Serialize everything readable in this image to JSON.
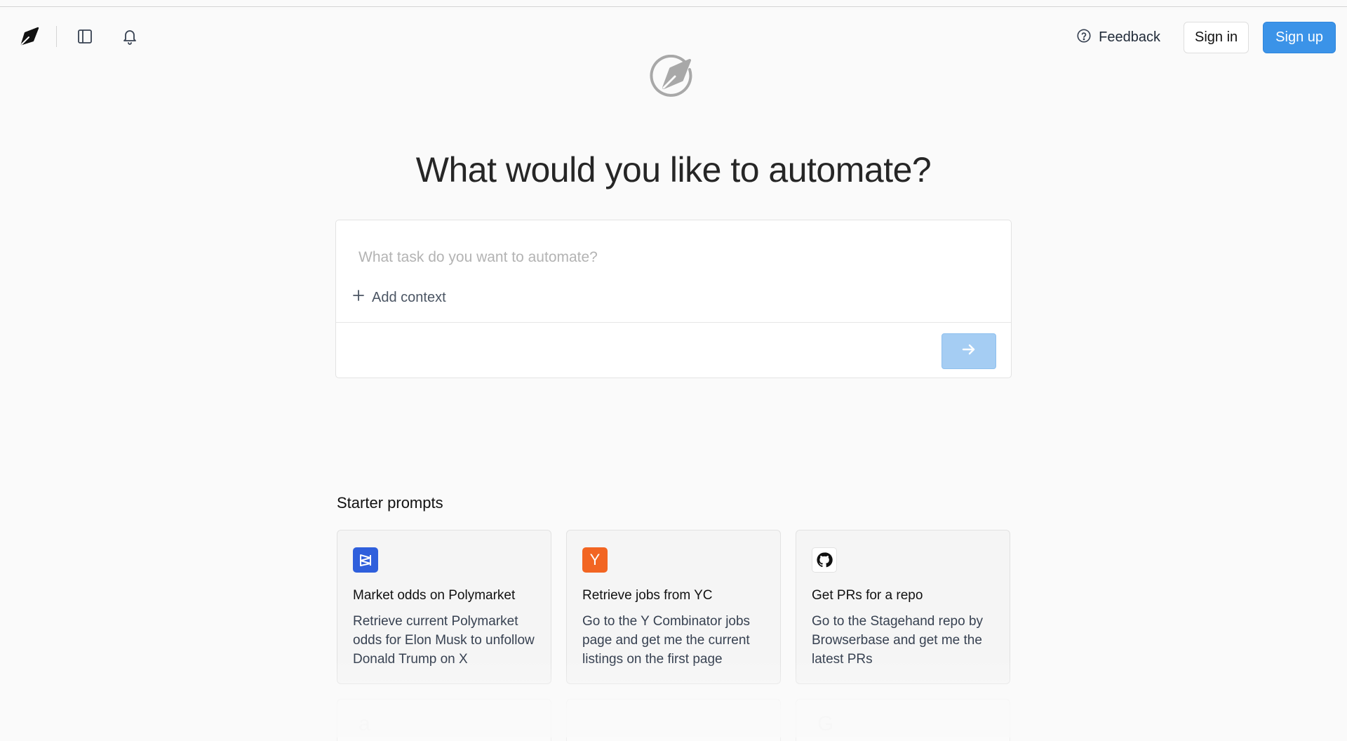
{
  "header": {
    "logo_icon": "quill-logo-icon",
    "sidebar_toggle_icon": "sidebar-panel-icon",
    "notifications_icon": "bell-icon",
    "feedback_label": "Feedback",
    "signin_label": "Sign in",
    "signup_label": "Sign up"
  },
  "hero": {
    "icon": "compass-quill-icon",
    "title": "What would you like to automate?"
  },
  "composer": {
    "placeholder": "What task do you want to automate?",
    "value": "",
    "add_context_label": "Add context",
    "send_icon": "arrow-right-icon"
  },
  "starter": {
    "title": "Starter prompts",
    "cards": [
      {
        "icon": "polymarket-logo",
        "title": "Market odds on Polymarket",
        "description": "Retrieve current Polymarket odds for Elon Musk to unfollow Donald Trump on X"
      },
      {
        "icon": "ycombinator-logo",
        "logo_text": "Y",
        "title": "Retrieve jobs from YC",
        "description": "Go to the Y Combinator jobs page and get me the current listings on the first page"
      },
      {
        "icon": "github-logo",
        "title": "Get PRs for a repo",
        "description": "Go to the Stagehand repo by Browserbase and get me the latest PRs"
      }
    ],
    "faded_cards": [
      {
        "glyph": "a"
      },
      {
        "glyph": ""
      },
      {
        "glyph": "G"
      }
    ]
  },
  "colors": {
    "accent": "#3b93e8",
    "send_disabled": "#a5cdf3",
    "background": "#fafafa"
  }
}
